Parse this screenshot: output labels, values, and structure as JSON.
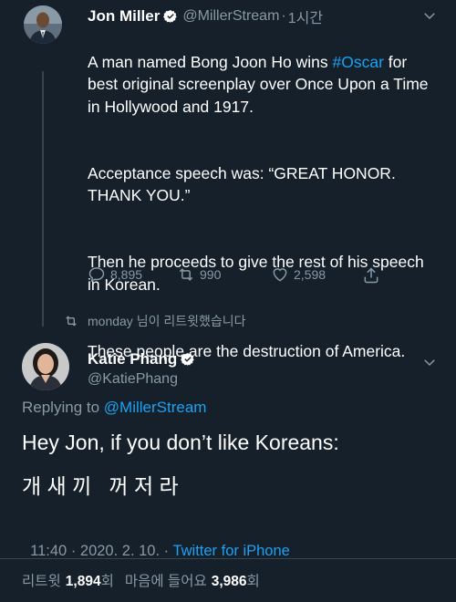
{
  "first_tweet": {
    "display_name": "Jon Miller",
    "handle": "@MillerStream",
    "time": "1시간",
    "text_before_hashtag": "A man named Bong Joon Ho wins ",
    "hashtag": "#Oscar",
    "text_after_hashtag": " for best original screenplay over Once Upon a Time in Hollywood and 1917.",
    "paragraph_2": "Acceptance speech was: “GREAT HONOR. THANK YOU.”",
    "paragraph_3": "Then he proceeds to give the rest of his speech in Korean.",
    "paragraph_4": "These people are the destruction of America.",
    "replies": "8,895",
    "retweets": "990",
    "likes": "2,598"
  },
  "retweet_context": {
    "text": "monday 님이 리트윗했습니다"
  },
  "main_tweet": {
    "display_name": "Katie Phang",
    "handle": "@KatiePhang",
    "replying_prefix": "Replying to ",
    "replying_handle": "@MillerStream",
    "line_1": "Hey Jon, if you don’t like Koreans:",
    "line_2": "개 새 끼   꺼 저 라",
    "timestamp": "11:40 · 2020. 2. 10. · ",
    "source": "Twitter for iPhone",
    "retweet_label": "리트윗",
    "retweet_count": "1,894",
    "retweet_suffix": "회",
    "like_label": "마음에 들어요",
    "like_count": "3,986",
    "like_suffix": "회"
  },
  "colors": {
    "background": "#15202b",
    "secondary_text": "#8899a6",
    "accent": "#1da1f2",
    "divider": "#38444d"
  }
}
